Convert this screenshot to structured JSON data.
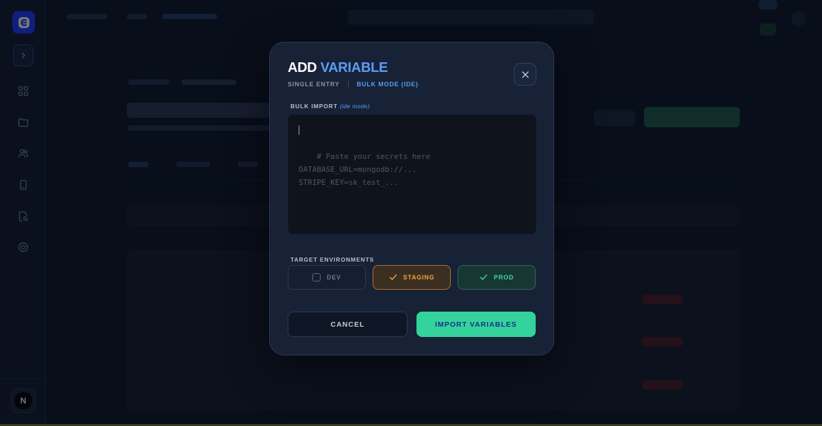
{
  "modal": {
    "title_prefix": "ADD",
    "title_accent": "VARIABLE",
    "tabs": [
      {
        "label": "SINGLE ENTRY",
        "active": false
      },
      {
        "label": "BULK MODE (IDE)",
        "active": true
      }
    ],
    "bulk_import": {
      "label": "BULK IMPORT",
      "hint": "(ide mode)",
      "placeholder": "# Paste your secrets here\nDATABASE_URL=mongodb://...\nSTRIPE_KEY=sk_test_...",
      "value": ""
    },
    "target_environments": {
      "label": "TARGET ENVIRONMENTS",
      "options": [
        {
          "label": "DEV",
          "checked": false,
          "color": "#6f7b90"
        },
        {
          "label": "STAGING",
          "checked": true,
          "color": "#f0a33a"
        },
        {
          "label": "PROD",
          "checked": true,
          "color": "#41d6a5"
        }
      ]
    },
    "buttons": {
      "cancel": "CANCEL",
      "import": "IMPORT VARIABLES"
    },
    "close_icon": "close-icon"
  },
  "sidebar": {
    "icons": [
      "app-logo-icon",
      "chevron-right-icon",
      "grid-icon",
      "folder-icon",
      "users-icon",
      "mobile-icon",
      "document-search-icon",
      "target-icon"
    ],
    "avatar_initial": "N"
  },
  "colors": {
    "accent_blue": "#5b9cf6",
    "accent_green": "#34d39b",
    "accent_orange": "#f0a33a",
    "brand_blue": "#1e3bff"
  }
}
